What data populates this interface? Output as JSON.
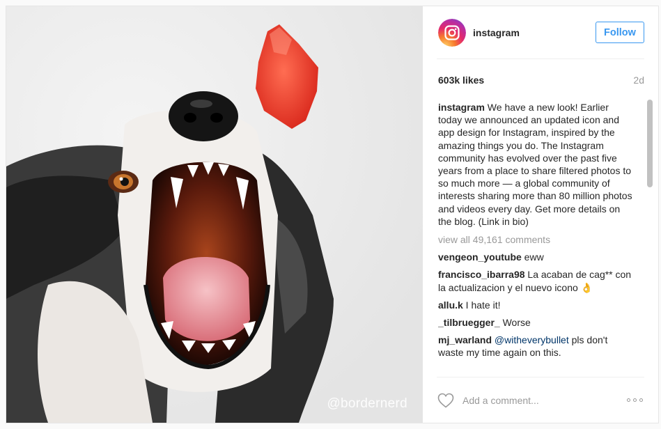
{
  "account": {
    "username": "instagram",
    "follow_label": "Follow"
  },
  "post": {
    "likes": "603k likes",
    "age": "2d",
    "watermark": "@bordernerd",
    "caption_user": "instagram",
    "caption_text": " We have a new look! Earlier today we announced an updated icon and app design for Instagram, inspired by the amazing things you do. The Instagram community has evolved over the past five years from a place to share filtered photos to so much more — a global community of interests sharing more than 80 million photos and videos every day. Get more details on the blog. (Link in bio)",
    "view_all": "view all 49,161 comments"
  },
  "comments": [
    {
      "user": "vengeon_youtube",
      "text": " eww"
    },
    {
      "user": "francisco_ibarra98",
      "text": " La acaban de cag** con la actualizacion y el nuevo icono 👌"
    },
    {
      "user": "allu.k",
      "text": " I hate it!"
    },
    {
      "user": "_tilbruegger_",
      "text": " Worse"
    },
    {
      "user": "mj_warland",
      "mention": "@witheverybullet",
      "text": " pls don't waste my time again on this."
    }
  ],
  "footer": {
    "comment_placeholder": "Add a comment..."
  },
  "icons": {
    "avatar": "instagram-logo-icon",
    "like": "heart-icon",
    "more": "more-options-icon"
  },
  "colors": {
    "link_blue": "#3897f0",
    "muted": "#999999",
    "text": "#262626"
  }
}
